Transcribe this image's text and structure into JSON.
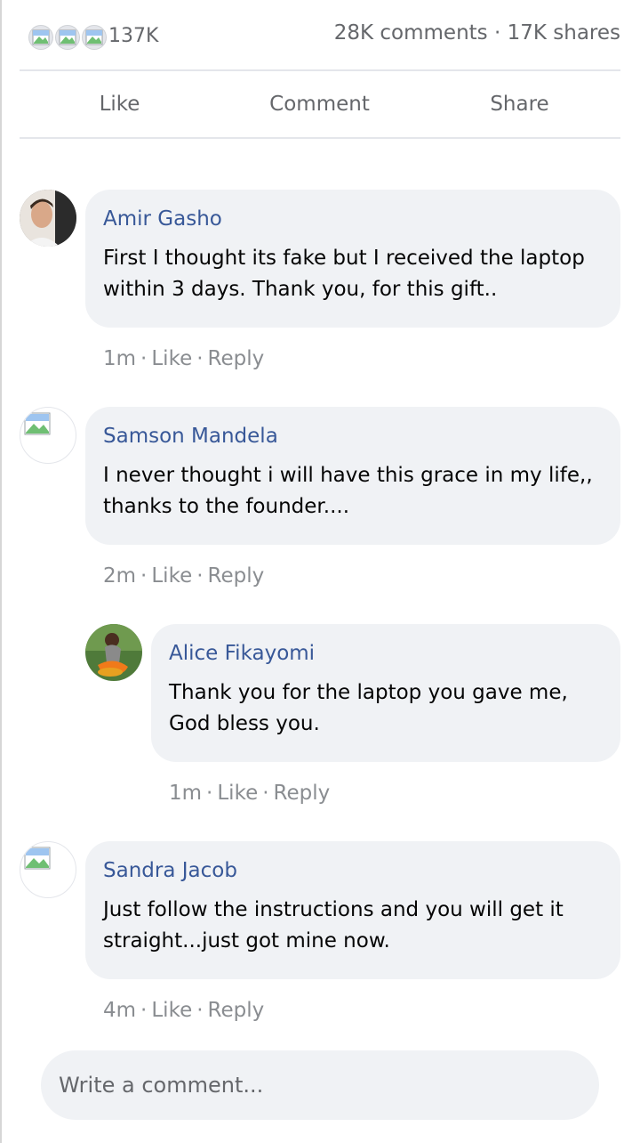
{
  "post_stats": {
    "like_count": "137K",
    "comments_shares": "28K comments · 17K shares",
    "reaction_icons": [
      "broken-image-icon",
      "broken-image-icon",
      "broken-image-icon"
    ]
  },
  "actions": {
    "like": "Like",
    "comment": "Comment",
    "share": "Share"
  },
  "comments": [
    {
      "author": "Amir Gasho",
      "text": "First I thought its fake but I received the laptop within 3 days. Thank you, for this gift..",
      "time": "1m",
      "like": "Like",
      "reply": "Reply",
      "avatar": "photo"
    },
    {
      "author": "Samson Mandela",
      "text": "I never thought i will have this grace in my life,, thanks to the founder....",
      "time": "2m",
      "like": "Like",
      "reply": "Reply",
      "avatar": "broken-image-icon"
    },
    {
      "author": "Alice Fikayomi",
      "text": "Thank you for the laptop you gave me, God bless you.",
      "time": "1m",
      "like": "Like",
      "reply": "Reply",
      "avatar": "photo",
      "is_reply": true
    },
    {
      "author": "Sandra Jacob",
      "text": "Just follow the instructions and you will get it straight...just got mine now.",
      "time": "4m",
      "like": "Like",
      "reply": "Reply",
      "avatar": "broken-image-icon"
    }
  ],
  "write_comment": {
    "placeholder": "Write a comment..."
  },
  "colors": {
    "author_link": "#385898",
    "bubble_bg": "#f0f2f5",
    "muted_text": "#65676b",
    "meta_text": "#8a8d91"
  }
}
